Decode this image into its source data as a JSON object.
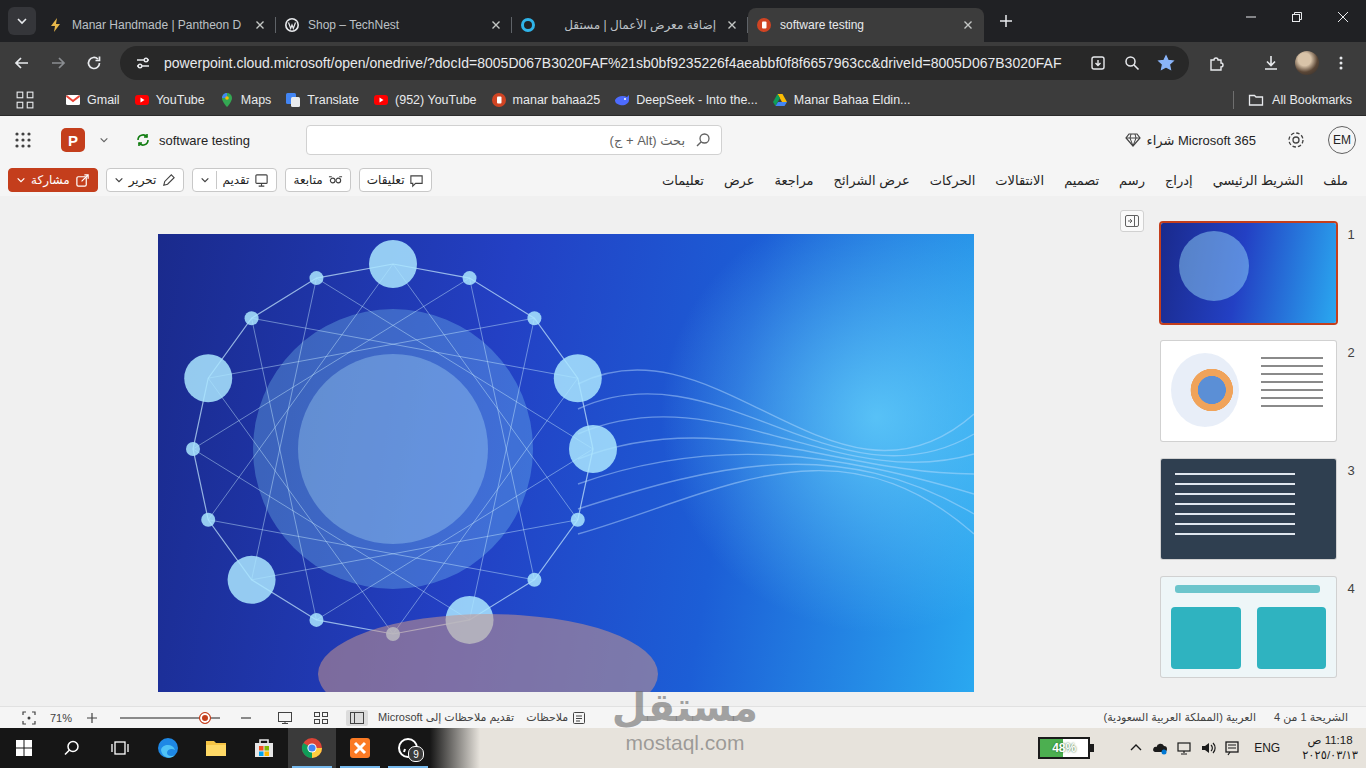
{
  "browser": {
    "tabs": [
      {
        "title": "Manar Handmade | Pantheon D",
        "selected": false
      },
      {
        "title": "Shop – TechNest",
        "selected": false
      },
      {
        "title": "إضافة معرض الأعمال | مستقل",
        "selected": false
      },
      {
        "title": "software testing",
        "selected": true
      }
    ],
    "url": "powerpoint.cloud.microsoft/open/onedrive/?docId=8005D067B3020FAF%21sb0bf9235226f4aeabbf0f8f6657963cc&driveId=8005D067B3020FAF",
    "bookmarked": true,
    "bookmarks": [
      "Gmail",
      "YouTube",
      "Maps",
      "Translate",
      "(952) YouTube",
      "manar bahaa25",
      "DeepSeek - Into the...",
      "Manar Bahaa Eldin..."
    ],
    "all_bookmarks": "All Bookmarks"
  },
  "app": {
    "logo_letter": "P",
    "document_title": "software testing",
    "search": {
      "placeholder": "بحث (Alt + ج)"
    },
    "buy": "Microsoft 365 شراء",
    "avatar": "EM",
    "actions": [
      {
        "label": "مشاركة",
        "kind": "primary"
      },
      {
        "label": "تحرير",
        "kind": "dropdown"
      },
      {
        "label": "تقديم",
        "kind": "split"
      },
      {
        "label": "متابعة",
        "kind": "plain"
      },
      {
        "label": "تعليقات",
        "kind": "plain"
      }
    ],
    "menu_tabs": [
      "ملف",
      "الشريط الرئيسي",
      "إدراج",
      "رسم",
      "تصميم",
      "الانتقالات",
      "الحركات",
      "عرض الشرائح",
      "مراجعة",
      "عرض",
      "تعليمات"
    ]
  },
  "thumbnails": [
    {
      "number": "1",
      "selected": true
    },
    {
      "number": "2",
      "selected": false
    },
    {
      "number": "3",
      "selected": false
    },
    {
      "number": "4",
      "selected": false
    }
  ],
  "status_bar": {
    "slide_position": "الشريحة 1 من 4",
    "language": "العربية (المملكة العربية السعودية)",
    "feedback": "تقديم ملاحظات إلى Microsoft",
    "notes": "ملاحظات",
    "views": [
      {
        "selected": false
      },
      {
        "selected": false
      },
      {
        "selected": true
      }
    ],
    "zoom": {
      "reading": "71%",
      "level": 0.85
    }
  },
  "watermark": {
    "title": "مستقل",
    "url": "mostaql.com"
  },
  "taskbar": {
    "apps": [
      {
        "selected": false,
        "running": false
      },
      {
        "selected": false,
        "running": false
      },
      {
        "selected": false,
        "running": false
      },
      {
        "selected": true,
        "running": true
      },
      {
        "selected": false,
        "running": true
      },
      {
        "selected": false,
        "running": true,
        "badge": "9"
      }
    ],
    "battery": {
      "reading": "48%",
      "level": 0.48
    },
    "language": "ENG",
    "time": "11:18 ص",
    "date": "٢٠٢٥/٠٣/١٣"
  }
}
